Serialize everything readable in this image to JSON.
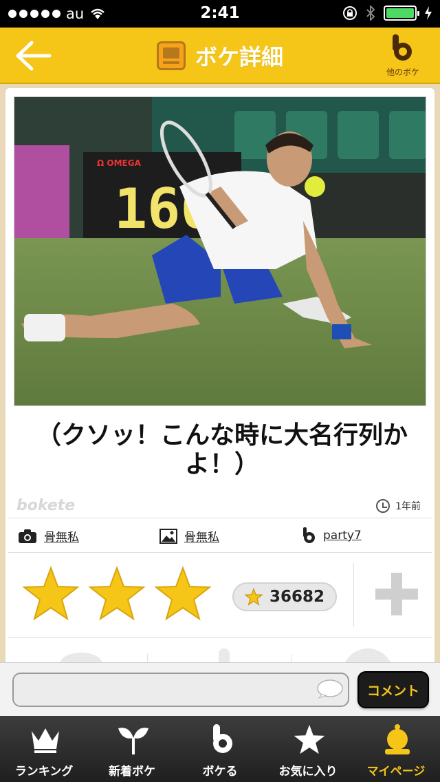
{
  "status": {
    "carrier": "au",
    "time": "2:41"
  },
  "header": {
    "title": "ボケ詳細",
    "other_label": "他のボケ"
  },
  "post": {
    "caption": "（クソッ！こんな時に大名行列かよ！）",
    "watermark": "bokete",
    "time_ago": "1年前",
    "photo_author": "骨無私",
    "image_author": "骨無私",
    "boke_author": "party7",
    "star_count": "36682",
    "stars": 3
  },
  "comment": {
    "placeholder": "",
    "button_label": "コメント"
  },
  "tabs": [
    {
      "label": "ランキング",
      "icon": "crown-icon"
    },
    {
      "label": "新着ボケ",
      "icon": "sprout-icon"
    },
    {
      "label": "ボケる",
      "icon": "bokete-b-icon"
    },
    {
      "label": "お気に入り",
      "icon": "star-icon"
    },
    {
      "label": "マイページ",
      "icon": "user-icon",
      "active": true
    }
  ],
  "colors": {
    "accent": "#f5c518",
    "star": "#f5c518",
    "tab_active": "#f5c518"
  }
}
